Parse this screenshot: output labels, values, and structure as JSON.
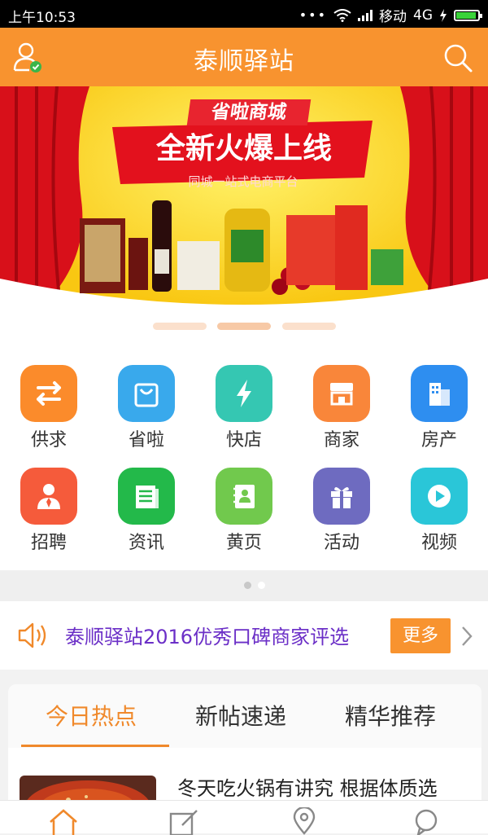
{
  "status_bar": {
    "time": "上午10:53",
    "dots": "•••",
    "carrier": "移动",
    "network": "4G",
    "battery_level": 1.0
  },
  "header": {
    "title": "泰顺驿站",
    "user_icon": "user-check-icon",
    "search_icon": "search-icon",
    "color": "#f8932f"
  },
  "banner": {
    "heading": "省啦商城",
    "headline": "全新火爆上线",
    "subline": "同城一站式电商平台",
    "active_slide": 2,
    "slide_count": 3
  },
  "grid": {
    "items": [
      {
        "label": "供求",
        "icon": "swap-arrows-icon",
        "color": "#fb8b2b"
      },
      {
        "label": "省啦",
        "icon": "shopping-bag-icon",
        "color": "#39a9ec"
      },
      {
        "label": "快店",
        "icon": "lightning-icon",
        "color": "#35c7b2"
      },
      {
        "label": "商家",
        "icon": "storefront-icon",
        "color": "#f9863a"
      },
      {
        "label": "房产",
        "icon": "building-icon",
        "color": "#2e8ef0"
      },
      {
        "label": "招聘",
        "icon": "person-tie-icon",
        "color": "#f55b3b"
      },
      {
        "label": "资讯",
        "icon": "newspaper-icon",
        "color": "#23b94a"
      },
      {
        "label": "黄页",
        "icon": "contact-book-icon",
        "color": "#71c94d"
      },
      {
        "label": "活动",
        "icon": "gift-icon",
        "color": "#6e6bc0"
      },
      {
        "label": "视频",
        "icon": "play-icon",
        "color": "#2ac6d8"
      }
    ],
    "page": 1,
    "page_count": 2
  },
  "notice": {
    "text": "泰顺驿站2016优秀口碑商家评选",
    "more_label": "更多",
    "speaker_icon": "speaker-icon",
    "arrow_icon": "chevron-right-icon"
  },
  "tabs": {
    "items": [
      "今日热点",
      "新帖速递",
      "精华推荐"
    ],
    "active": 0
  },
  "news": {
    "first_title": "冬天吃火锅有讲究 根据体质选"
  },
  "bottom_nav": {
    "icons": [
      "home-icon",
      "post-edit-icon",
      "location-pin-icon",
      "message-icon"
    ]
  }
}
